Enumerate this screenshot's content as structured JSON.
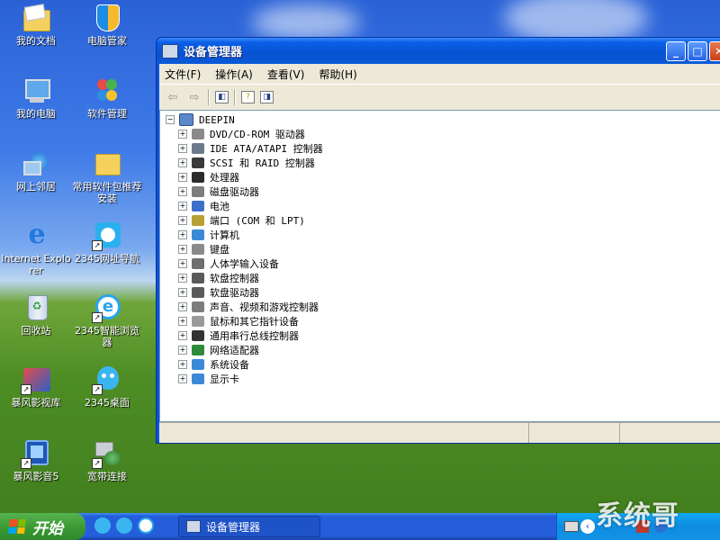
{
  "desktop": {
    "icons": [
      {
        "label": "我的文档"
      },
      {
        "label": "电脑管家"
      },
      {
        "label": "我的电脑"
      },
      {
        "label": "软件管理"
      },
      {
        "label": "网上邻居"
      },
      {
        "label": "常用软件包推荐安装"
      },
      {
        "label": "Internet Explorer"
      },
      {
        "label": "2345网址导航"
      },
      {
        "label": "回收站"
      },
      {
        "label": "2345智能浏览器"
      },
      {
        "label": "暴风影视库"
      },
      {
        "label": "2345桌面"
      },
      {
        "label": "暴风影音5"
      },
      {
        "label": "宽带连接"
      }
    ]
  },
  "window": {
    "title": "设备管理器",
    "controls": {
      "minimize": "_",
      "maximize": "□",
      "close": "✕"
    },
    "menu": [
      "文件(F)",
      "操作(A)",
      "查看(V)",
      "帮助(H)"
    ],
    "tree": {
      "root": "DEEPIN",
      "items": [
        {
          "label": "DVD/CD-ROM 驱动器",
          "icon": "cdrom-icon",
          "color": "#8a8a8a"
        },
        {
          "label": "IDE ATA/ATAPI 控制器",
          "icon": "ide-icon",
          "color": "#6c7a8c"
        },
        {
          "label": "SCSI 和 RAID 控制器",
          "icon": "scsi-icon",
          "color": "#3a3a3a"
        },
        {
          "label": "处理器",
          "icon": "cpu-icon",
          "color": "#2b2b2b"
        },
        {
          "label": "磁盘驱动器",
          "icon": "disk-icon",
          "color": "#7d7d7d"
        },
        {
          "label": "电池",
          "icon": "battery-icon",
          "color": "#3d6ec9"
        },
        {
          "label": "端口 (COM 和 LPT)",
          "icon": "port-icon",
          "color": "#b8a034"
        },
        {
          "label": "计算机",
          "icon": "computer-icon",
          "color": "#3b8ad8"
        },
        {
          "label": "键盘",
          "icon": "keyboard-icon",
          "color": "#8a8a8a"
        },
        {
          "label": "人体学输入设备",
          "icon": "hid-icon",
          "color": "#6f6f6f"
        },
        {
          "label": "软盘控制器",
          "icon": "floppy-controller-icon",
          "color": "#5a5a5a"
        },
        {
          "label": "软盘驱动器",
          "icon": "floppy-drive-icon",
          "color": "#5a5a5a"
        },
        {
          "label": "声音、视频和游戏控制器",
          "icon": "sound-icon",
          "color": "#7c7c7c"
        },
        {
          "label": "鼠标和其它指针设备",
          "icon": "mouse-icon",
          "color": "#9a9a9a"
        },
        {
          "label": "通用串行总线控制器",
          "icon": "usb-icon",
          "color": "#333333"
        },
        {
          "label": "网络适配器",
          "icon": "network-adapter-icon",
          "color": "#2e8b3a"
        },
        {
          "label": "系统设备",
          "icon": "system-device-icon",
          "color": "#3b8ad8"
        },
        {
          "label": "显示卡",
          "icon": "display-adapter-icon",
          "color": "#3b8ad8"
        }
      ]
    }
  },
  "taskbar": {
    "start_label": "开始",
    "task_button": "设备管理器",
    "tray_arrow": "‹"
  },
  "watermark": "系统哥"
}
